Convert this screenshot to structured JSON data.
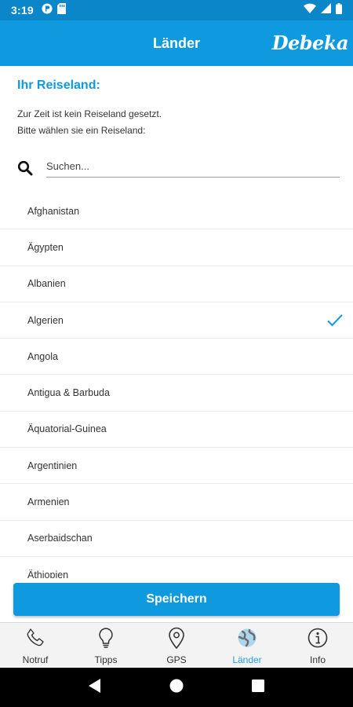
{
  "status_bar": {
    "time": "3:19",
    "left_icons": [
      "privacy-icon",
      "storage-icon"
    ],
    "right_icons": [
      "wifi-icon",
      "signal-icon",
      "battery-icon"
    ]
  },
  "header": {
    "title": "Länder",
    "brand": "Debeka"
  },
  "main": {
    "heading": "Ihr Reiseland:",
    "info_line1": "Zur Zeit ist kein Reiseland gesetzt.",
    "info_line2": "Bitte wählen sie ein Reiseland:",
    "search": {
      "placeholder": "Suchen...",
      "value": ""
    },
    "countries": [
      {
        "name": "Afghanistan",
        "selected": false
      },
      {
        "name": "Ägypten",
        "selected": false
      },
      {
        "name": "Albanien",
        "selected": false
      },
      {
        "name": "Algerien",
        "selected": true
      },
      {
        "name": "Angola",
        "selected": false
      },
      {
        "name": "Antigua & Barbuda",
        "selected": false
      },
      {
        "name": "Äquatorial-Guinea",
        "selected": false
      },
      {
        "name": "Argentinien",
        "selected": false
      },
      {
        "name": "Armenien",
        "selected": false
      },
      {
        "name": "Aserbaidschan",
        "selected": false
      },
      {
        "name": "Äthiopien",
        "selected": false
      }
    ],
    "save_label": "Speichern"
  },
  "bottom_nav": {
    "items": [
      {
        "label": "Notruf",
        "icon": "phone-icon",
        "active": false
      },
      {
        "label": "Tipps",
        "icon": "lightbulb-icon",
        "active": false
      },
      {
        "label": "GPS",
        "icon": "location-pin-icon",
        "active": false
      },
      {
        "label": "Länder",
        "icon": "globe-icon",
        "active": true
      },
      {
        "label": "Info",
        "icon": "info-icon",
        "active": false
      }
    ]
  },
  "system_nav": [
    "back-icon",
    "home-icon",
    "recents-icon"
  ],
  "colors": {
    "primary": "#0f9ae0",
    "status_bar": "#0a86c9",
    "active_nav": "#2b9fde",
    "nav_background": "#f3f3f3"
  }
}
